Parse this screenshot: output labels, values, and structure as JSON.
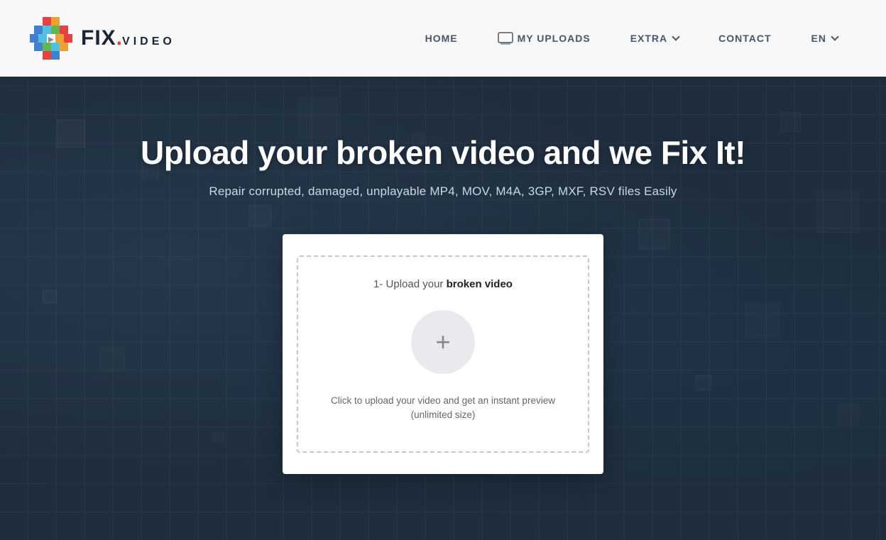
{
  "header": {
    "logo_fix": "FIX.",
    "logo_video": "VIDEO",
    "nav": {
      "home_label": "HOME",
      "uploads_label": "MY UPLOADS",
      "extra_label": "EXTRA",
      "contact_label": "CONTACT",
      "lang_label": "EN"
    }
  },
  "hero": {
    "title": "Upload your broken video and we Fix It!",
    "subtitle": "Repair corrupted, damaged, unplayable MP4, MOV, M4A, 3GP, MXF, RSV files Easily",
    "upload_card": {
      "label_prefix": "1- Upload your ",
      "label_bold": "broken video",
      "hint_line1": "Click to upload your video and get an instant preview",
      "hint_line2": "(unlimited size)",
      "plus_symbol": "+"
    }
  }
}
